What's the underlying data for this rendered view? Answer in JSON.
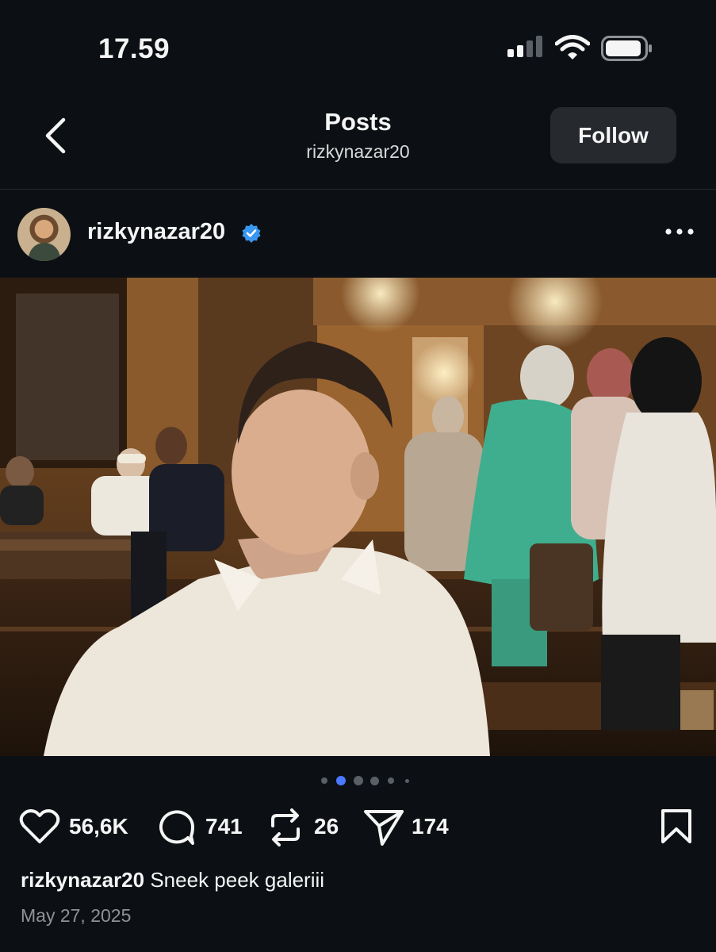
{
  "status_bar": {
    "time": "17.59",
    "icons": [
      "signal-icon",
      "wifi-icon",
      "battery-icon"
    ]
  },
  "nav": {
    "title": "Posts",
    "subtitle": "rizkynazar20",
    "follow_label": "Follow",
    "back_icon": "chevron-left-icon"
  },
  "post": {
    "username": "rizkynazar20",
    "verified": true,
    "more_icon": "more-horizontal-icon",
    "carousel": {
      "total": 6,
      "active": 1
    },
    "actions": {
      "likes": "56,6K",
      "comments": "741",
      "reposts": "26",
      "shares": "174"
    },
    "caption_user": "rizkynazar20",
    "caption_text": "Sneek peek galeriii",
    "date": "May 27, 2025"
  },
  "colors": {
    "background": "#0c1014",
    "verified_blue": "#3897f0",
    "active_dot": "#4a78ff",
    "button_bg": "#262a2f"
  }
}
